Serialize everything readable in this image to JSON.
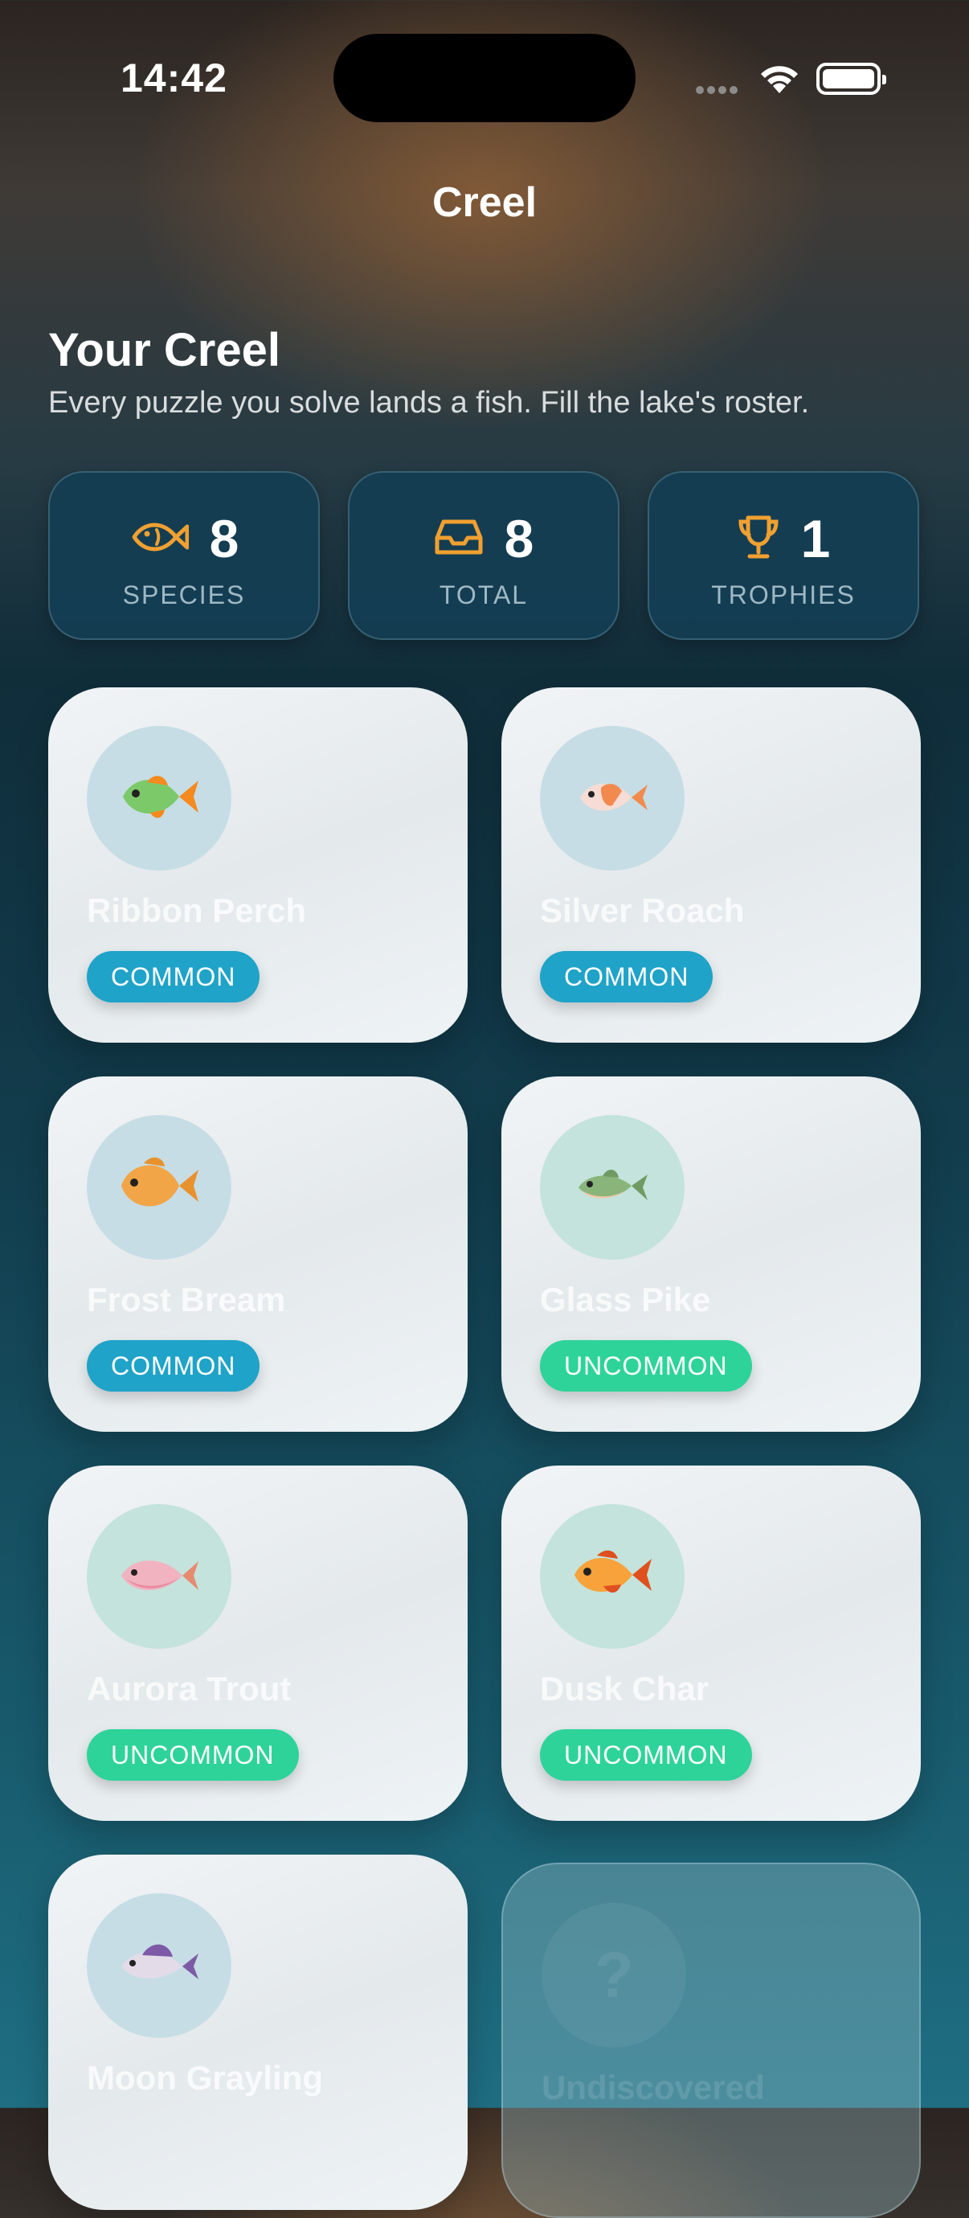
{
  "status_bar": {
    "time": "14:42"
  },
  "nav": {
    "title": "Creel"
  },
  "header": {
    "title": "Your Creel",
    "subtitle": "Every puzzle you solve lands a fish. Fill the lake's roster."
  },
  "stats": [
    {
      "icon": "fish-icon",
      "value": "8",
      "label": "SPECIES"
    },
    {
      "icon": "tray-icon",
      "value": "8",
      "label": "TOTAL"
    },
    {
      "icon": "trophy-icon",
      "value": "1",
      "label": "TROPHIES"
    }
  ],
  "colors": {
    "accent_icon": "#f0a030",
    "common": "#1fa3c8",
    "uncommon": "#2ed39a"
  },
  "fish": [
    {
      "name": "Ribbon Perch",
      "rarity": "COMMON",
      "emoji": "🐠"
    },
    {
      "name": "Silver Roach",
      "rarity": "COMMON",
      "emoji": "🐟"
    },
    {
      "name": "Frost Bream",
      "rarity": "COMMON",
      "emoji": "🐡"
    },
    {
      "name": "Glass Pike",
      "rarity": "UNCOMMON",
      "emoji": "🐟"
    },
    {
      "name": "Aurora Trout",
      "rarity": "UNCOMMON",
      "emoji": "🐟"
    },
    {
      "name": "Dusk Char",
      "rarity": "UNCOMMON",
      "emoji": "🐠"
    },
    {
      "name": "Moon Grayling",
      "rarity": "",
      "emoji": "🐟"
    },
    {
      "name": "Undiscovered",
      "rarity": "",
      "emoji": "?"
    }
  ]
}
